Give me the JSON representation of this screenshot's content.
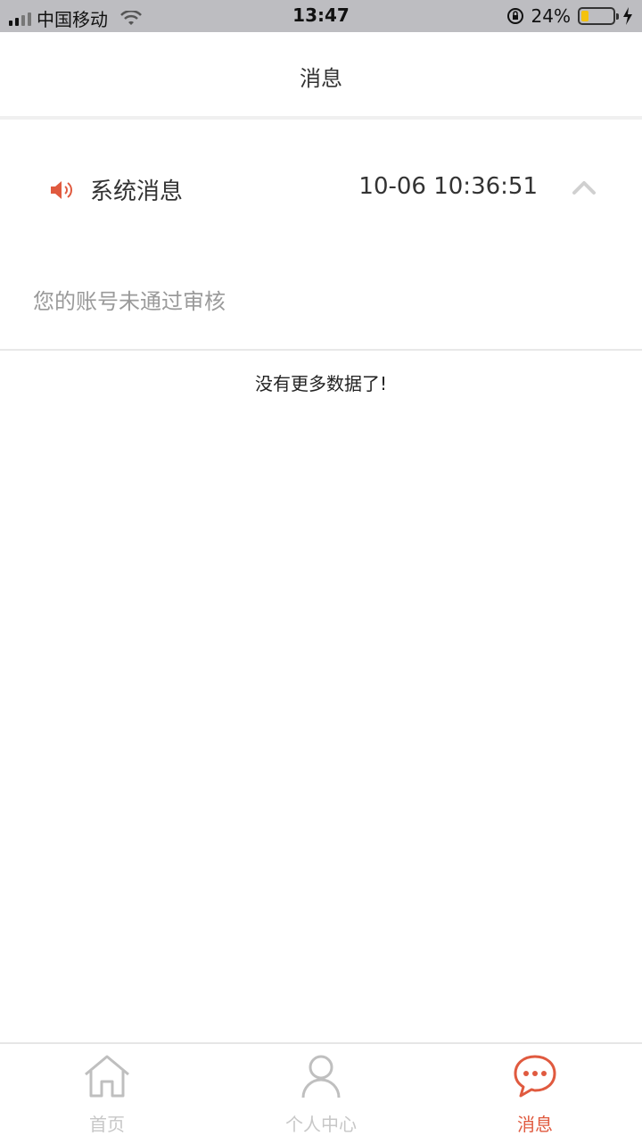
{
  "status_bar": {
    "carrier": "中国移动",
    "time": "13:47",
    "battery": "24%",
    "battery_level": 0.24
  },
  "nav": {
    "title": "消息"
  },
  "message": {
    "title": "系统消息",
    "timestamp": "10-06 10:36:51",
    "body": "您的账号未通过审核"
  },
  "list_footer": {
    "no_more_text": "没有更多数据了!"
  },
  "tabs": [
    {
      "label": "首页",
      "icon": "home-icon"
    },
    {
      "label": "个人中心",
      "icon": "person-icon"
    },
    {
      "label": "消息",
      "icon": "chat-bubble-icon"
    }
  ],
  "colors": {
    "accent": "#e05a3f",
    "inactive": "#c7c7c7"
  }
}
